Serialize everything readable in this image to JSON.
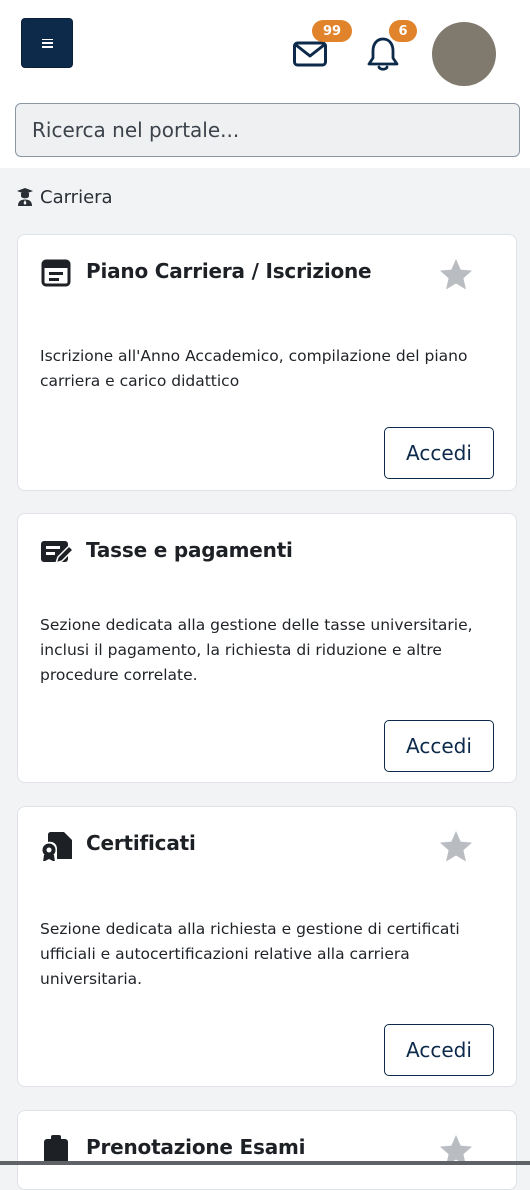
{
  "header": {
    "menu_icon": "hamburger-icon",
    "mail_icon": "envelope-icon",
    "mail_count": "99",
    "bell_icon": "bell-icon",
    "notification_count": "6",
    "badge_color": "#e0832a",
    "brand_color": "#0d2a4a"
  },
  "search": {
    "placeholder": "Ricerca nel portale..."
  },
  "section": {
    "icon": "graduate-icon",
    "label": "Carriera"
  },
  "cards": [
    {
      "icon": "calendar-note-icon",
      "title": "Piano Carriera / Iscrizione",
      "starred_icon": "star-icon",
      "description": "Iscrizione all'Anno Accademico, compilazione del piano carriera e carico didattico",
      "button": "Accedi"
    },
    {
      "icon": "edit-document-icon",
      "title": "Tasse e pagamenti",
      "description": "Sezione dedicata alla gestione delle tasse universitarie, inclusi il pagamento, la richiesta di riduzione e altre procedure correlate.",
      "button": "Accedi"
    },
    {
      "icon": "certificate-icon",
      "title": "Certificati",
      "starred_icon": "star-icon",
      "description": "Sezione dedicata alla richiesta e gestione di certificati ufficiali e autocertificazioni relative alla carriera universitaria.",
      "button": "Accedi"
    },
    {
      "icon": "clipboard-icon",
      "title": "Prenotazione Esami",
      "starred_icon": "star-icon"
    }
  ]
}
